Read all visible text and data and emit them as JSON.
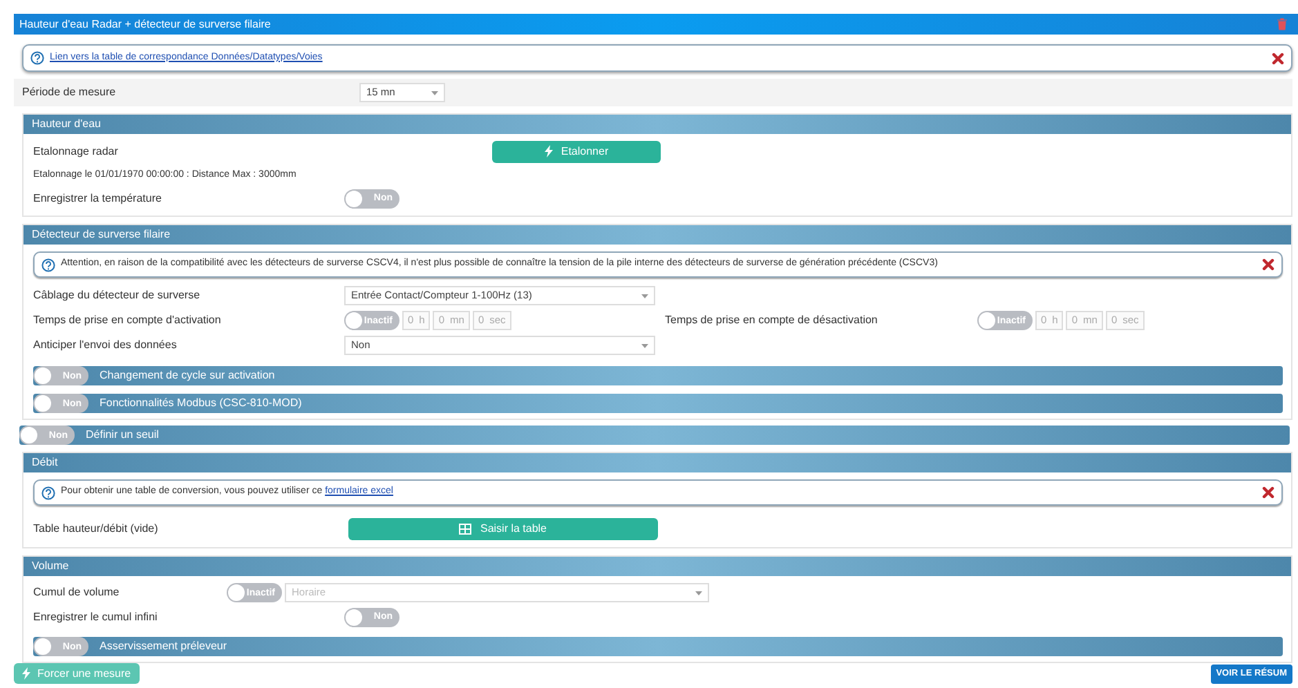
{
  "window": {
    "title": "Hauteur d'eau Radar + détecteur de surverse filaire"
  },
  "info": {
    "link": "Lien vers la table de correspondance Données/Datatypes/Voies"
  },
  "period": {
    "label": "Période de mesure",
    "value": "15 mn"
  },
  "sections": [
    {
      "kind": "panel",
      "title": "Hauteur d'eau",
      "items": [
        {
          "kind": "button_row",
          "label": "Etalonnage radar",
          "button": "Etalonner"
        },
        {
          "kind": "text",
          "text": "Etalonnage le 01/01/1970 00:00:00 : Distance Max : 3000mm"
        },
        {
          "kind": "toggle_row",
          "label": "Enregistrer la température",
          "toggle": {
            "label": "Non",
            "on": false
          }
        }
      ]
    },
    {
      "kind": "panel",
      "title": "Détecteur de surverse filaire",
      "items": [
        {
          "kind": "notice",
          "text": "Attention, en raison de la compatibilité avec les détecteurs de surverse CSCV4, il n'est plus possible de connaître la tension de la pile interne des détecteurs de surverse de génération précédente (CSCV3)"
        },
        {
          "kind": "select_row",
          "label": "Câblage du détecteur de surverse",
          "value": "Entrée Contact/Compteur 1-100Hz (13)"
        },
        {
          "kind": "timer_row",
          "label": "Temps de prise en compte d'activation",
          "toggle": {
            "label": "Inactif",
            "on": false
          },
          "disabled": true,
          "fields": [
            {
              "value": "0",
              "unit": "h"
            },
            {
              "value": "0",
              "unit": "mn"
            },
            {
              "value": "0",
              "unit": "sec"
            }
          ],
          "second": {
            "label": "Temps de prise en compte de désactivation",
            "toggle": {
              "label": "Inactif",
              "on": false
            },
            "disabled": true,
            "fields": [
              {
                "value": "0",
                "unit": "h"
              },
              {
                "value": "0",
                "unit": "mn"
              },
              {
                "value": "0",
                "unit": "sec"
              }
            ]
          }
        },
        {
          "kind": "select_row",
          "label": "Anticiper l'envoi des données",
          "value": "Non"
        },
        {
          "kind": "toggle_bar",
          "label": "Changement de cycle sur activation",
          "toggle": {
            "label": "Non",
            "on": false
          }
        },
        {
          "kind": "toggle_bar",
          "label": "Fonctionnalités Modbus (CSC-810-MOD)",
          "toggle": {
            "label": "Non",
            "on": false
          }
        }
      ]
    },
    {
      "kind": "toggle_bar",
      "label": "Définir un seuil",
      "toggle": {
        "label": "Non",
        "on": false
      }
    },
    {
      "kind": "panel",
      "title": "Débit",
      "items": [
        {
          "kind": "notice",
          "text": "Pour obtenir une table de conversion, vous pouvez utiliser ce ",
          "link": "formulaire excel"
        },
        {
          "kind": "wide_button_row",
          "label": "Table hauteur/débit (vide)",
          "button": "Saisir la table"
        }
      ]
    },
    {
      "kind": "panel",
      "title": "Volume",
      "items": [
        {
          "kind": "toggle_select_row",
          "label": "Cumul de volume",
          "toggle": {
            "label": "Inactif",
            "on": false
          },
          "disabled": true,
          "value": "Horaire"
        },
        {
          "kind": "toggle_row",
          "label": "Enregistrer le cumul infini",
          "toggle": {
            "label": "Non",
            "on": false
          }
        },
        {
          "kind": "toggle_bar",
          "label": "Asservissement préleveur",
          "toggle": {
            "label": "Non",
            "on": false
          }
        }
      ]
    }
  ],
  "footer": {
    "force_button": "Forcer une mesure",
    "summary_button": "VOIR LE RÉSUM"
  }
}
